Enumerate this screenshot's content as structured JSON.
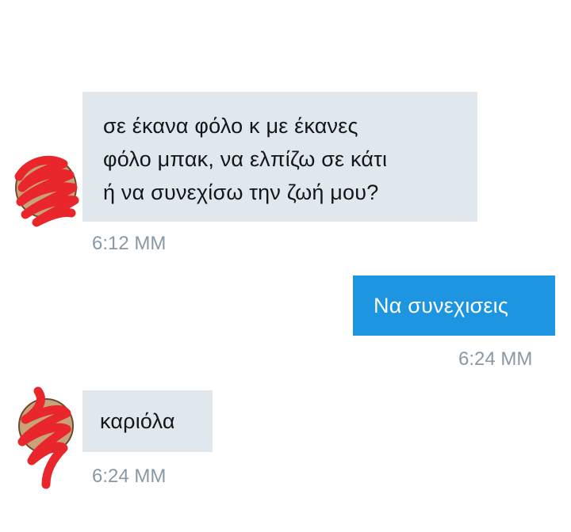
{
  "conversation": {
    "messages": [
      {
        "direction": "incoming",
        "lines": [
          "σε έκανα φόλο κ με έκανες",
          "φόλο μπακ, να ελπίζω σε κάτι",
          "ή να συνεχίσω την ζωή μου?"
        ],
        "time": "6:12 ΜΜ"
      },
      {
        "direction": "outgoing",
        "lines": [
          "Να συνεχισεις"
        ],
        "time": "6:24 ΜΜ"
      },
      {
        "direction": "incoming",
        "lines": [
          "καριόλα"
        ],
        "time": "6:24 ΜΜ"
      }
    ]
  },
  "colors": {
    "incoming_bubble": "#e1e8ed",
    "outgoing_bubble": "#1d95e0",
    "timestamp": "#8899a6",
    "redaction_scribble": "#e8262b"
  }
}
